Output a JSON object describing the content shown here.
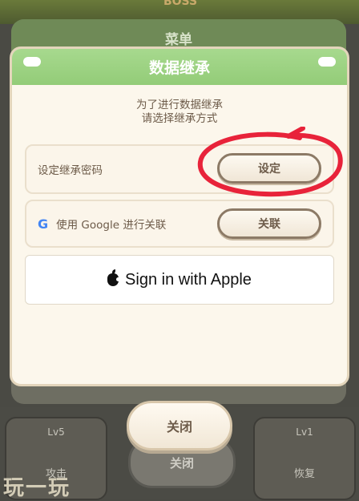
{
  "background": {
    "boss_text": "BOSS",
    "menu_title": "菜单",
    "behind_close_label": "关闭",
    "cards": [
      {
        "level": "Lv5",
        "name": "攻击"
      },
      {
        "level": "Lv1",
        "name": "恢复"
      }
    ],
    "watermark": "玩一玩"
  },
  "dialog": {
    "title": "数据继承",
    "subtitle_line1": "为了进行数据继承",
    "subtitle_line2": "请选择继承方式",
    "password_row": {
      "label": "设定继承密码",
      "button": "设定"
    },
    "google_row": {
      "icon_text": "G",
      "label": "使用 Google 进行关联",
      "button": "关联"
    },
    "apple_button": "Sign in with Apple"
  },
  "close_button": "关闭",
  "colors": {
    "header_green": "#9dd383",
    "annotation_red": "#e8233a",
    "text_brown": "#6d5b49"
  }
}
